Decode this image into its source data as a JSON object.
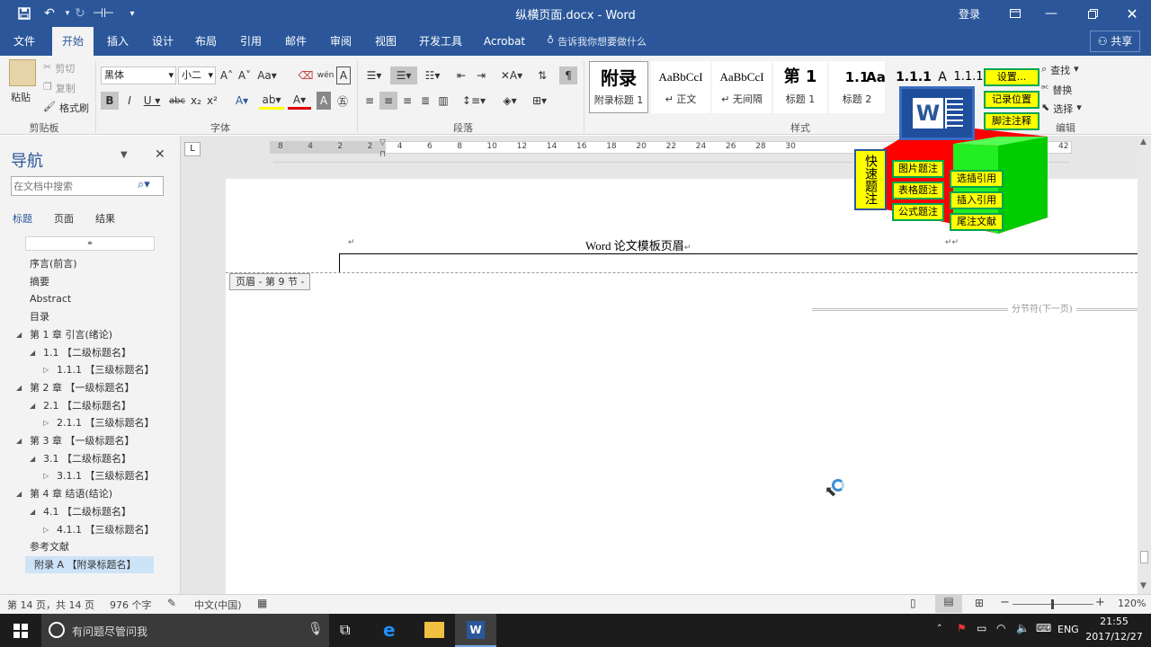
{
  "window": {
    "title": "纵横页面.docx - Word",
    "login": "登录"
  },
  "tabs": [
    "文件",
    "开始",
    "插入",
    "设计",
    "布局",
    "引用",
    "邮件",
    "审阅",
    "视图",
    "开发工具",
    "Acrobat"
  ],
  "tell_me": "告诉我你想要做什么",
  "share": "共享",
  "ribbon": {
    "clipboard": {
      "paste": "粘贴",
      "cut": "剪切",
      "copy": "复制",
      "format_painter": "格式刷",
      "label": "剪贴板"
    },
    "font": {
      "name": "黑体",
      "size": "小二",
      "label": "字体"
    },
    "paragraph": {
      "label": "段落"
    },
    "styles": {
      "label": "样式",
      "items": [
        {
          "preview": "附录",
          "name": "附录标题 1"
        },
        {
          "preview": "AaBbCcI",
          "name": "↵ 正文"
        },
        {
          "preview": "AaBbCcI",
          "name": "↵ 无间隔"
        },
        {
          "preview": "第 1",
          "name": "标题 1"
        },
        {
          "preview": "1.1",
          "name": "标题 2"
        },
        {
          "preview": "Aa",
          "name": ""
        },
        {
          "preview": "1.1.1",
          "name": ""
        },
        {
          "preview": "A",
          "name": ""
        },
        {
          "preview": "1.1.1",
          "name": ""
        }
      ]
    },
    "editing": {
      "find": "查找",
      "replace": "替换",
      "select": "选择",
      "label": "编辑"
    }
  },
  "nav": {
    "title": "导航",
    "search_placeholder": "在文档中搜索",
    "tabs": [
      "标题",
      "页面",
      "结果"
    ],
    "items": [
      {
        "text": "序言(前言)",
        "indent": 0,
        "arrow": ""
      },
      {
        "text": "摘要",
        "indent": 0,
        "arrow": ""
      },
      {
        "text": "Abstract",
        "indent": 0,
        "arrow": ""
      },
      {
        "text": "目录",
        "indent": 0,
        "arrow": ""
      },
      {
        "text": "第 1 章 引言(绪论)",
        "indent": 0,
        "arrow": "◢"
      },
      {
        "text": "1.1 【二级标题名】",
        "indent": 1,
        "arrow": "◢"
      },
      {
        "text": "1.1.1 【三级标题名】",
        "indent": 2,
        "arrow": "▷"
      },
      {
        "text": "第 2 章 【一级标题名】",
        "indent": 0,
        "arrow": "◢"
      },
      {
        "text": "2.1 【二级标题名】",
        "indent": 1,
        "arrow": "◢"
      },
      {
        "text": "2.1.1 【三级标题名】",
        "indent": 2,
        "arrow": "▷"
      },
      {
        "text": "第 3 章 【一级标题名】",
        "indent": 0,
        "arrow": "◢"
      },
      {
        "text": "3.1 【二级标题名】",
        "indent": 1,
        "arrow": "◢"
      },
      {
        "text": "3.1.1 【三级标题名】",
        "indent": 2,
        "arrow": "▷"
      },
      {
        "text": "第 4 章 结语(结论)",
        "indent": 0,
        "arrow": "◢"
      },
      {
        "text": "4.1 【二级标题名】",
        "indent": 1,
        "arrow": "◢"
      },
      {
        "text": "4.1.1 【三级标题名】",
        "indent": 2,
        "arrow": "▷"
      },
      {
        "text": "参考文献",
        "indent": 0,
        "arrow": ""
      },
      {
        "text": "附录 A 【附录标题名】",
        "indent": 0,
        "arrow": "",
        "selected": true
      }
    ]
  },
  "ruler": [
    "8",
    "4",
    "2",
    "2",
    "4",
    "6",
    "8",
    "10",
    "12",
    "14",
    "16",
    "18",
    "20",
    "22",
    "24",
    "26",
    "28",
    "30",
    "42"
  ],
  "document": {
    "header_text": "Word 论文模板页眉",
    "header_label": "页眉 - 第 9 节 -",
    "section_break": "分节符(下一页)"
  },
  "addin": {
    "quick": "快速题注",
    "buttons_left": [
      "图片题注",
      "表格题注",
      "公式题注"
    ],
    "buttons_mid": [
      "选插引用",
      "插入引用",
      "尾注文献"
    ],
    "buttons_right": [
      "设置...",
      "记录位置",
      "脚注注释"
    ]
  },
  "status": {
    "page": "第 14 页，共 14 页",
    "words": "976 个字",
    "lang": "中文(中国)",
    "zoom": "120%"
  },
  "taskbar": {
    "search": "有问题尽管问我",
    "lang": "ENG",
    "time": "21:55",
    "date": "2017/12/27"
  }
}
